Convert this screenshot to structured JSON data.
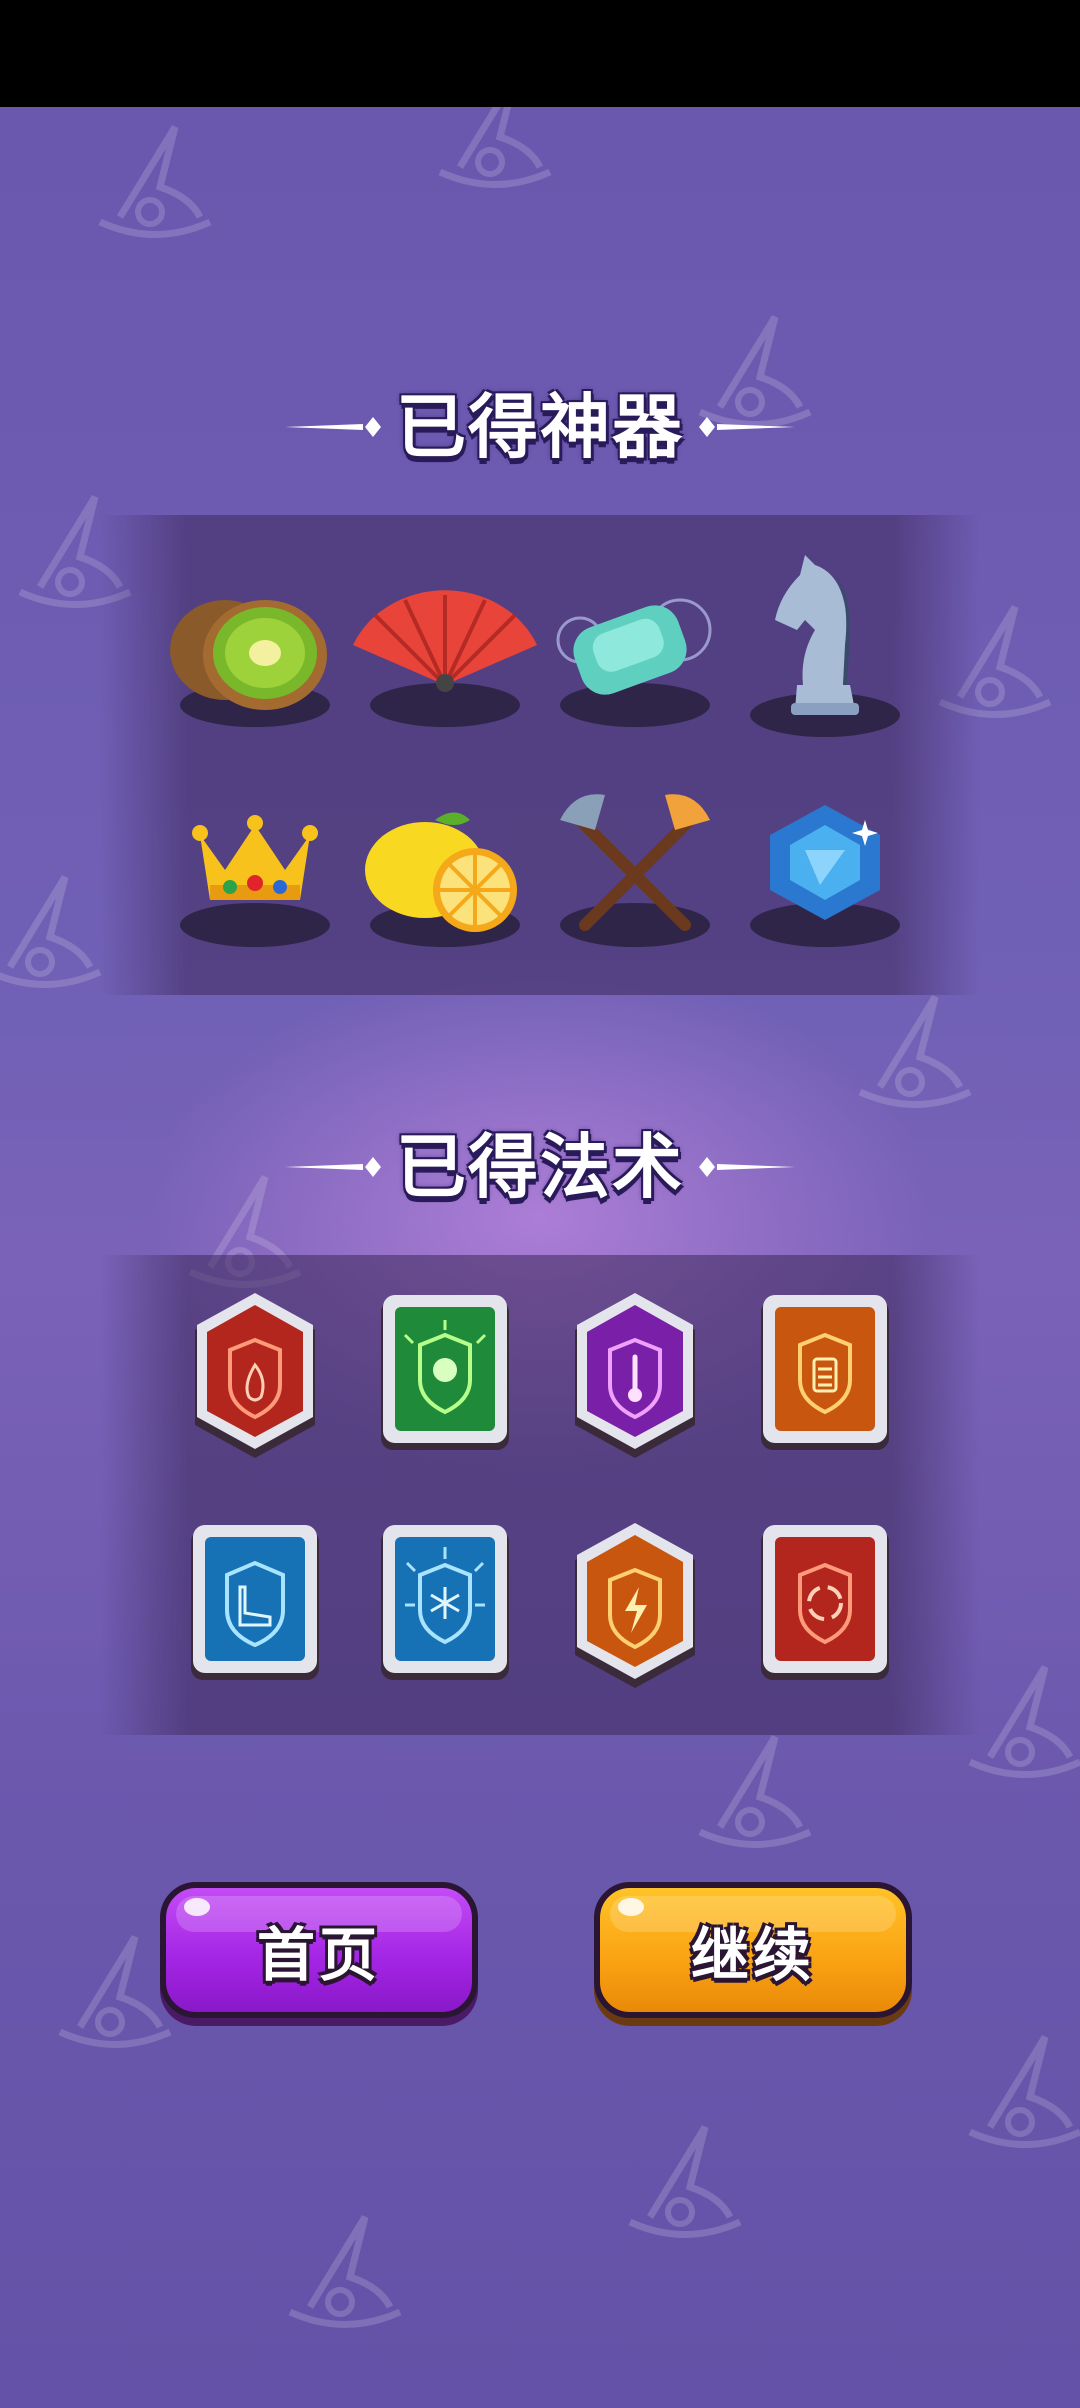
{
  "colors": {
    "background": "#6b58ad",
    "home_button": "#a526e6",
    "continue_button": "#fba414",
    "title_text": "#ffffff"
  },
  "artifacts_section": {
    "title": "已得神器",
    "items": [
      {
        "icon": "kiwi-icon"
      },
      {
        "icon": "red-fan-icon"
      },
      {
        "icon": "soap-icon"
      },
      {
        "icon": "chess-knight-icon"
      },
      {
        "icon": "crown-icon"
      },
      {
        "icon": "lemon-icon"
      },
      {
        "icon": "crossed-axes-icon"
      },
      {
        "icon": "blue-gem-icon"
      }
    ]
  },
  "spells_section": {
    "title": "已得法术",
    "items": [
      {
        "icon": "fire-shield-spell-icon",
        "color": "#b3261e"
      },
      {
        "icon": "skull-shield-spell-icon",
        "color": "#1f8a3a"
      },
      {
        "icon": "temperature-shield-spell-icon",
        "color": "#7a1fa8"
      },
      {
        "icon": "battery-shield-spell-icon",
        "color": "#c9560f"
      },
      {
        "icon": "boot-shield-spell-icon",
        "color": "#1771b5"
      },
      {
        "icon": "frost-shield-spell-icon",
        "color": "#1771b5"
      },
      {
        "icon": "lightning-shield-spell-icon",
        "color": "#c9560f"
      },
      {
        "icon": "cycle-shield-spell-icon",
        "color": "#b3261e"
      }
    ]
  },
  "buttons": {
    "home_label": "首页",
    "continue_label": "继续"
  }
}
